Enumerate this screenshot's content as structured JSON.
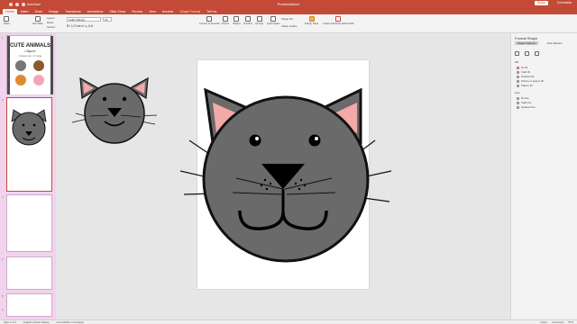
{
  "window": {
    "autosave": "AutoSave",
    "title": "Presentation2"
  },
  "tabs": [
    {
      "label": "Home"
    },
    {
      "label": "Insert"
    },
    {
      "label": "Draw"
    },
    {
      "label": "Design"
    },
    {
      "label": "Transitions"
    },
    {
      "label": "Animations"
    },
    {
      "label": "Slide Show"
    },
    {
      "label": "Review"
    },
    {
      "label": "View"
    },
    {
      "label": "Acrobat"
    },
    {
      "label": "Shape Format"
    },
    {
      "label": "Tell me"
    }
  ],
  "header_buttons": {
    "share": "Share",
    "comments": "Comments"
  },
  "ribbon": {
    "paste": "Paste",
    "new_slide": "New Slide",
    "layout": "Layout",
    "reset": "Reset",
    "section": "Section",
    "font_name": "Calibri (Body)",
    "font_size": "18",
    "format_row": "B  I  U  S  ab  x²  x₂  A  A",
    "convert_smartart": "Convert to SmartArt",
    "picture": "Picture",
    "shapes": "Shapes",
    "text_box": "Text Box",
    "arrange": "Arrange",
    "quick_styles": "Quick Styles",
    "shape_fill": "Shape Fill",
    "shape_outline": "Shape Outline",
    "design_ideas": "Design Ideas",
    "create_share": "Create and Share Adobe PDF"
  },
  "thumbnails": {
    "slide1_title": "CUTE ANIMALS",
    "slide1_subtitle": "clipart",
    "slide1_caption": "POWERPOINT TUTORIAL",
    "numbers": [
      "1",
      "2",
      "3",
      "4",
      "5",
      "6"
    ]
  },
  "format_pane": {
    "title": "Format Shape",
    "tab_shape": "Shape Options",
    "tab_text": "Text Options",
    "fill_header": "Fill",
    "fill_options": [
      "No fill",
      "Solid fill",
      "Gradient fill",
      "Picture or texture fill",
      "Pattern fill"
    ],
    "line_header": "Line",
    "line_options": [
      "No line",
      "Solid line",
      "Gradient line"
    ]
  },
  "status": {
    "slide": "Slide 2 of 6",
    "language": "English (United States)",
    "accessibility": "Accessibility: Investigate",
    "notes": "Notes",
    "comments": "Comments",
    "zoom": "87%"
  },
  "colors": {
    "accent": "#c24a37",
    "cat_fill": "#6a6a6a",
    "ear_inner": "#f4a9a8",
    "thumb_panel": "#f2d3ee"
  }
}
